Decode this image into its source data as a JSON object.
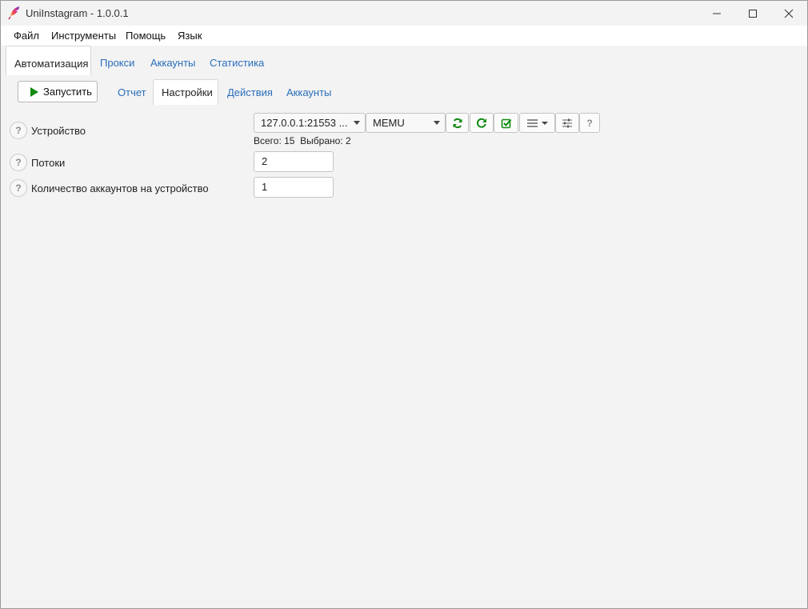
{
  "window": {
    "title": "UniInstagram - 1.0.0.1"
  },
  "menu": [
    "Файл",
    "Инструменты",
    "Помощь",
    "Язык"
  ],
  "top_tabs": [
    {
      "label": "Автоматизация",
      "active": true
    },
    {
      "label": "Прокси",
      "active": false
    },
    {
      "label": "Аккаунты",
      "active": false
    },
    {
      "label": "Статистика",
      "active": false
    }
  ],
  "toolbar": {
    "run_label": "Запустить"
  },
  "sub_tabs": [
    {
      "label": "Отчет",
      "active": false
    },
    {
      "label": "Настройки",
      "active": true
    },
    {
      "label": "Действия",
      "active": false
    },
    {
      "label": "Аккаунты",
      "active": false
    }
  ],
  "settings": {
    "device": {
      "label": "Устройство",
      "device_select": "127.0.0.1:21553 ...",
      "emulator_select": "MEMU",
      "total": "Всего: 15",
      "selected": "Выбрано: 2"
    },
    "threads": {
      "label": "Потоки",
      "value": "2"
    },
    "accounts_per_device": {
      "label": "Количество аккаунтов на устройство",
      "value": "1"
    }
  },
  "icons": {
    "app": "feather-icon",
    "sync": "sync-icon",
    "refresh": "refresh-icon",
    "check": "check-square-icon",
    "list": "list-icon",
    "sliders": "sliders-icon",
    "help": "question-icon"
  },
  "colors": {
    "link": "#2a6ebb",
    "accent_green": "#128a12"
  }
}
